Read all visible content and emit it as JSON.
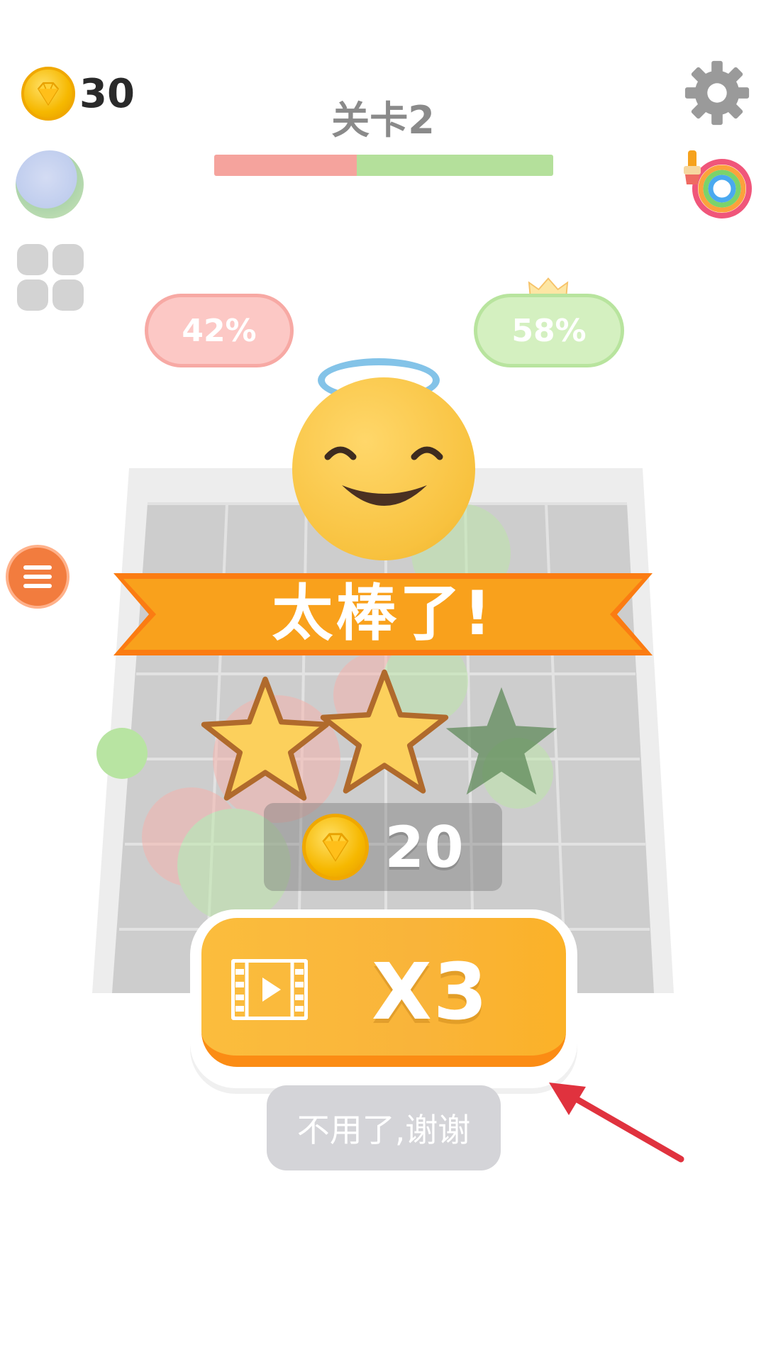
{
  "hud": {
    "coins": "30",
    "level_title": "关卡2",
    "progress_red_fraction": 0.42
  },
  "scores": {
    "player_percent": "42%",
    "opponent_percent": "58%"
  },
  "result": {
    "banner": "太棒了!",
    "stars_earned": 2,
    "stars_total": 3,
    "reward_coins": "20"
  },
  "actions": {
    "multiplier_label": "X3",
    "decline_label": "不用了,谢谢"
  },
  "icons": {
    "coin": "coin-icon",
    "settings": "gear-icon",
    "paint": "paint-brush-wheel-icon",
    "globe": "globe-icon",
    "grid": "grid-icon",
    "menu": "menu-icon",
    "crown": "crown-icon",
    "video": "film-icon"
  },
  "colors": {
    "red_team": "#f5a39d",
    "green_team": "#b4e09b",
    "banner": "#f9a11c",
    "button": "#f9b43a",
    "arrow": "#e0323e"
  }
}
